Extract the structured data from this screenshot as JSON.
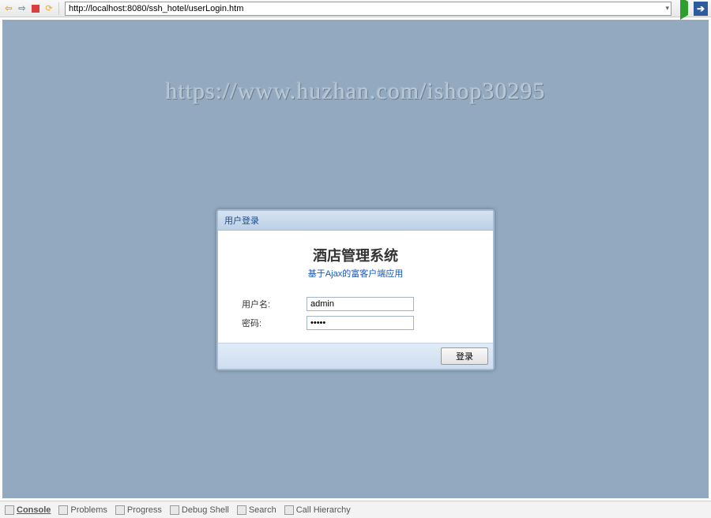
{
  "toolbar": {
    "url": "http://localhost:8080/ssh_hotel/userLogin.htm"
  },
  "watermark": "https://www.huzhan.com/ishop30295",
  "login": {
    "panel_title": "用户登录",
    "system_title": "酒店管理系统",
    "subtitle": "基于Ajax的富客户端应用",
    "username_label": "用户名:",
    "username_value": "admin",
    "password_label": "密码:",
    "password_value": "•••••",
    "login_button": "登录"
  },
  "status_tabs": {
    "console": "Console",
    "problems": "Problems",
    "progress": "Progress",
    "debug_shell": "Debug Shell",
    "search": "Search",
    "call_hierarchy": "Call Hierarchy"
  }
}
